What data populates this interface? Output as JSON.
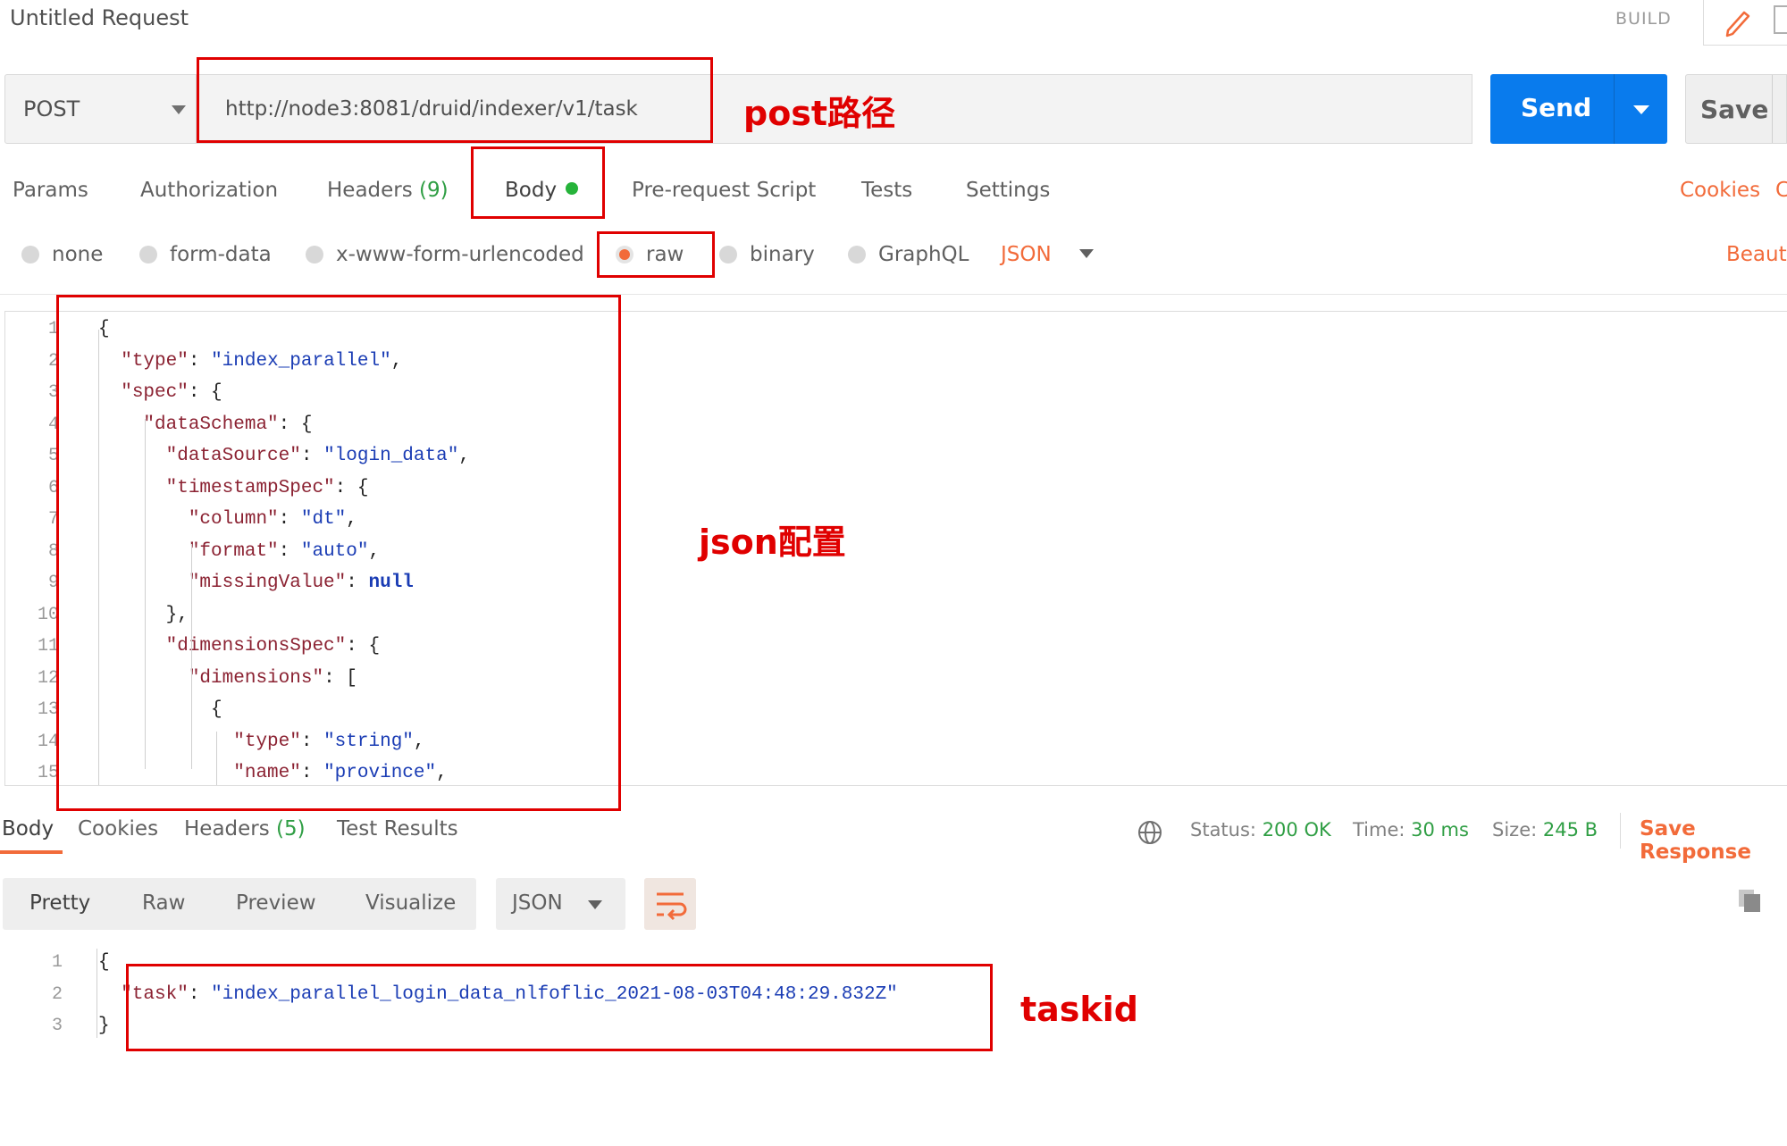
{
  "header": {
    "title": "Untitled Request",
    "build_label": "BUILD"
  },
  "request": {
    "method": "POST",
    "url": "http://node3:8081/druid/indexer/v1/task",
    "send_label": "Send",
    "save_label": "Save"
  },
  "tabs": {
    "params": "Params",
    "authorization": "Authorization",
    "headers": "Headers",
    "headers_count": "(9)",
    "body": "Body",
    "prerequest": "Pre-request Script",
    "tests": "Tests",
    "settings": "Settings",
    "cookies": "Cookies",
    "code_partial": "C"
  },
  "body_types": {
    "none": "none",
    "form_data": "form-data",
    "urlencoded": "x-www-form-urlencoded",
    "raw": "raw",
    "binary": "binary",
    "graphql": "GraphQL",
    "format": "JSON",
    "beautify": "Beauti"
  },
  "editor": {
    "line_numbers": [
      "1",
      "2",
      "3",
      "4",
      "5",
      "6",
      "7",
      "8",
      "9",
      "10",
      "11",
      "12",
      "13",
      "14",
      "15"
    ],
    "lines": [
      "{",
      "  \"type\": \"index_parallel\",",
      "  \"spec\": {",
      "    \"dataSchema\": {",
      "      \"dataSource\": \"login_data\",",
      "      \"timestampSpec\": {",
      "        \"column\": \"dt\",",
      "        \"format\": \"auto\",",
      "        \"missingValue\": null",
      "      },",
      "      \"dimensionsSpec\": {",
      "        \"dimensions\": [",
      "          {",
      "            \"type\": \"string\",",
      "            \"name\": \"province\","
    ]
  },
  "response": {
    "tabs": {
      "body": "Body",
      "cookies": "Cookies",
      "headers": "Headers",
      "headers_count": "(5)",
      "test_results": "Test Results"
    },
    "status_label": "Status:",
    "status_value": "200 OK",
    "time_label": "Time:",
    "time_value": "30 ms",
    "size_label": "Size:",
    "size_value": "245 B",
    "save_response": "Save Response",
    "views": {
      "pretty": "Pretty",
      "raw": "Raw",
      "preview": "Preview",
      "visualize": "Visualize"
    },
    "format": "JSON",
    "line_numbers": [
      "1",
      "2",
      "3"
    ],
    "lines": [
      "{",
      "  \"task\": \"index_parallel_login_data_nlfoflic_2021-08-03T04:48:29.832Z\"",
      "}"
    ]
  },
  "annotations": {
    "post_path": "post路径",
    "json_config": "json配置",
    "taskid": "taskid"
  }
}
